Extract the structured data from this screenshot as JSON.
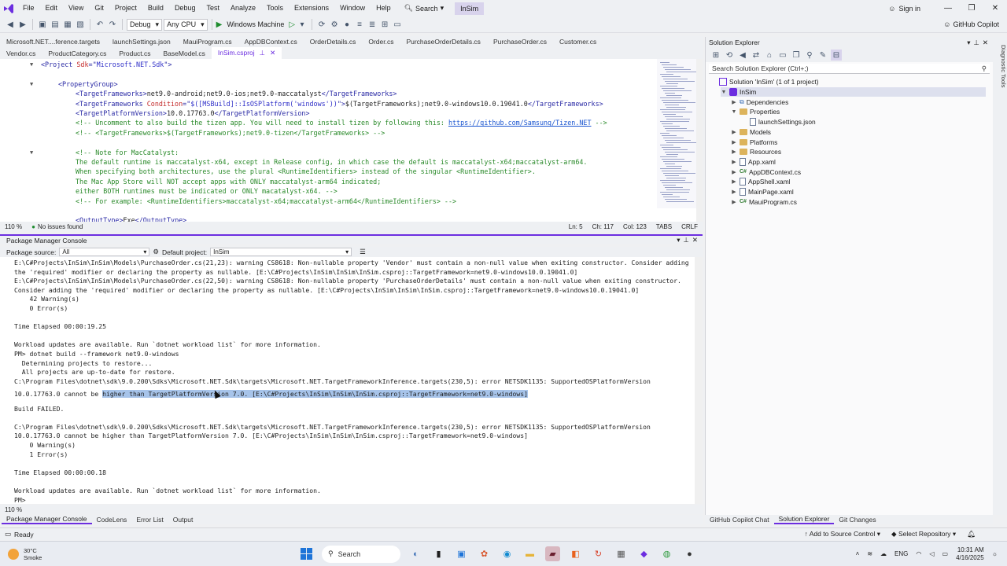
{
  "colors": {
    "accent": "#6c2ee0",
    "selection": "#a7c4ea",
    "xml_tag": "#2a2aa5",
    "xml_attr": "#c42a2a",
    "comment": "#2a8a2a"
  },
  "menubar": {
    "items": [
      "File",
      "Edit",
      "View",
      "Git",
      "Project",
      "Build",
      "Debug",
      "Test",
      "Analyze",
      "Tools",
      "Extensions",
      "Window",
      "Help"
    ],
    "search_label": "Search",
    "solution_name": "InSim",
    "sign_in": "Sign in"
  },
  "toolbar": {
    "config": "Debug",
    "platform": "Any CPU",
    "run_target": "Windows Machine",
    "copilot": "GitHub Copilot"
  },
  "doc_tabs_row1": [
    "Microsoft.NET....ference.targets",
    "launchSettings.json",
    "MauiProgram.cs",
    "AppDBContext.cs",
    "OrderDetails.cs",
    "Order.cs",
    "PurchaseOrderDetails.cs",
    "PurchaseOrder.cs",
    "Customer.cs"
  ],
  "doc_tabs_row2": [
    "Vendor.cs",
    "ProductCategory.cs",
    "Product.cs",
    "BaseModel.cs"
  ],
  "active_tab": "InSim.csproj",
  "editor": {
    "lines": [
      {
        "parts": [
          [
            "tag",
            "<Project "
          ],
          [
            "attr",
            "Sdk"
          ],
          [
            "tag",
            "=\""
          ],
          [
            "val",
            "Microsoft.NET.Sdk"
          ],
          [
            "tag",
            "\">"
          ]
        ]
      },
      {
        "parts": []
      },
      {
        "parts": [
          [
            "tag",
            "<PropertyGroup>"
          ]
        ]
      },
      {
        "parts": [
          [
            "tag",
            "<TargetFrameworks>"
          ],
          [
            "text",
            "net9.0-android;net9.0-ios;net9.0-maccatalyst"
          ],
          [
            "tag",
            "</TargetFrameworks>"
          ]
        ]
      },
      {
        "parts": [
          [
            "tag",
            "<TargetFrameworks "
          ],
          [
            "attr",
            "Condition"
          ],
          [
            "tag",
            "=\""
          ],
          [
            "val",
            "$([MSBuild]::IsOSPlatform('windows'))"
          ],
          [
            "tag",
            "\">"
          ],
          [
            "text",
            "$(TargetFrameworks);net9.0-windows10.0.19041.0"
          ],
          [
            "tag",
            "</TargetFrameworks>"
          ]
        ]
      },
      {
        "parts": [
          [
            "tag",
            "<TargetPlatformVersion>"
          ],
          [
            "text",
            "10.0.17763.0"
          ],
          [
            "tag",
            "</TargetPlatformVersion>"
          ]
        ]
      },
      {
        "parts": [
          [
            "comment",
            "<!-- Uncomment to also build the tizen app. You will need to install tizen by following this: "
          ],
          [
            "link",
            "https://github.com/Samsung/Tizen.NET"
          ],
          [
            "comment",
            " -->"
          ]
        ]
      },
      {
        "parts": [
          [
            "comment",
            "<!-- <TargetFrameworks>$(TargetFrameworks);net9.0-tizen</TargetFrameworks> -->"
          ]
        ]
      },
      {
        "parts": []
      },
      {
        "parts": [
          [
            "comment",
            "<!-- Note for MacCatalyst:"
          ]
        ]
      },
      {
        "parts": [
          [
            "comment",
            "The default runtime is maccatalyst-x64, except in Release config, in which case the default is maccatalyst-x64;maccatalyst-arm64."
          ]
        ]
      },
      {
        "parts": [
          [
            "comment",
            "When specifying both architectures, use the plural <RuntimeIdentifiers> instead of the singular <RuntimeIdentifier>."
          ]
        ]
      },
      {
        "parts": [
          [
            "comment",
            "The Mac App Store will NOT accept apps with ONLY maccatalyst-arm64 indicated;"
          ]
        ]
      },
      {
        "parts": [
          [
            "comment",
            "either BOTH runtimes must be indicated or ONLY macatalyst-x64. -->"
          ]
        ]
      },
      {
        "parts": [
          [
            "comment",
            "<!-- For example: <RuntimeIdentifiers>maccatalyst-x64;maccatalyst-arm64</RuntimeIdentifiers> -->"
          ]
        ]
      },
      {
        "parts": []
      },
      {
        "parts": [
          [
            "tag",
            "<OutputType>"
          ],
          [
            "text",
            "Exe"
          ],
          [
            "tag",
            "</OutputType>"
          ]
        ]
      }
    ]
  },
  "editor_status": {
    "zoom": "110 %",
    "issues": "No issues found",
    "ln": "Ln: 5",
    "ch": "Ch: 117",
    "col": "Col: 123",
    "tabs": "TABS",
    "eol": "CRLF"
  },
  "pmc": {
    "title": "Package Manager Console",
    "source_label": "Package source:",
    "source_value": "All",
    "project_label": "Default project:",
    "project_value": "InSim",
    "lines": [
      "E:\\C#Projects\\InSim\\InSim\\Models\\PurchaseOrder.cs(21,23): warning CS8618: Non-nullable property 'Vendor' must contain a non-null value when exiting constructor. Consider adding",
      "the 'required' modifier or declaring the property as nullable. [E:\\C#Projects\\InSim\\InSim\\InSim.csproj::TargetFramework=net9.0-windows10.0.19041.0]",
      "E:\\C#Projects\\InSim\\InSim\\Models\\PurchaseOrder.cs(22,50): warning CS8618: Non-nullable property 'PurchaseOrderDetails' must contain a non-null value when exiting constructor.",
      "Consider adding the 'required' modifier or declaring the property as nullable. [E:\\C#Projects\\InSim\\InSim\\InSim.csproj::TargetFramework=net9.0-windows10.0.19041.0]",
      "    42 Warning(s)",
      "    0 Error(s)",
      "",
      "Time Elapsed 00:00:19.25",
      "",
      "Workload updates are available. Run `dotnet workload list` for more information.",
      "PM> dotnet build --framework net9.0-windows",
      "  Determining projects to restore...",
      "  All projects are up-to-date for restore.",
      "C:\\Program Files\\dotnet\\sdk\\9.0.200\\Sdks\\Microsoft.NET.Sdk\\targets\\Microsoft.NET.TargetFrameworkInference.targets(230,5): error NETSDK1135: SupportedOSPlatformVersion",
      "",
      "",
      "Build FAILED.",
      "",
      "C:\\Program Files\\dotnet\\sdk\\9.0.200\\Sdks\\Microsoft.NET.Sdk\\targets\\Microsoft.NET.TargetFrameworkInference.targets(230,5): error NETSDK1135: SupportedOSPlatformVersion",
      "10.0.17763.0 cannot be higher than TargetPlatformVersion 7.0. [E:\\C#Projects\\InSim\\InSim\\InSim.csproj::TargetFramework=net9.0-windows]",
      "    0 Warning(s)",
      "    1 Error(s)",
      "",
      "Time Elapsed 00:00:00.18",
      "",
      "Workload updates are available. Run `dotnet workload list` for more information.",
      "PM>"
    ],
    "selected_prefix": "10.0.17763.0 cannot be ",
    "selected_text": "higher than TargetPlatformVersion 7.0. [E:\\C#Projects\\InSim\\InSim\\InSim.csproj::TargetFramework=net9.0-windows]",
    "zoom": "110 %"
  },
  "bottom_tabs_left": [
    "Package Manager Console",
    "CodeLens",
    "Error List",
    "Output"
  ],
  "bottom_tabs_right": [
    "GitHub Copilot Chat",
    "Solution Explorer",
    "Git Changes"
  ],
  "solution_explorer": {
    "title": "Solution Explorer",
    "search_placeholder": "Search Solution Explorer (Ctrl+;)",
    "items": [
      {
        "label": "Solution 'InSim' (1 of 1 project)",
        "icon": "solution-icon",
        "indent": 0,
        "chev": ""
      },
      {
        "label": "InSim",
        "icon": "project-icon",
        "indent": 1,
        "chev": "▼"
      },
      {
        "label": "Dependencies",
        "icon": "dependencies-icon",
        "indent": 2,
        "chev": "▶"
      },
      {
        "label": "Properties",
        "icon": "folder-icon",
        "indent": 2,
        "chev": "▼"
      },
      {
        "label": "launchSettings.json",
        "icon": "file-icon",
        "indent": 3,
        "chev": ""
      },
      {
        "label": "Models",
        "icon": "folder-icon",
        "indent": 2,
        "chev": "▶"
      },
      {
        "label": "Platforms",
        "icon": "folder-icon",
        "indent": 2,
        "chev": "▶"
      },
      {
        "label": "Resources",
        "icon": "folder-icon",
        "indent": 2,
        "chev": "▶"
      },
      {
        "label": "App.xaml",
        "icon": "file-icon",
        "indent": 2,
        "chev": "▶"
      },
      {
        "label": "AppDBContext.cs",
        "icon": "csharp-icon",
        "indent": 2,
        "chev": "▶"
      },
      {
        "label": "AppShell.xaml",
        "icon": "file-icon",
        "indent": 2,
        "chev": "▶"
      },
      {
        "label": "MainPage.xaml",
        "icon": "file-icon",
        "indent": 2,
        "chev": "▶"
      },
      {
        "label": "MauiProgram.cs",
        "icon": "csharp-icon",
        "indent": 2,
        "chev": "▶"
      }
    ]
  },
  "diagnostic_tools": "Diagnostic Tools",
  "statusbar": {
    "ready": "Ready",
    "add_source_control": "Add to Source Control",
    "select_repository": "Select Repository"
  },
  "taskbar": {
    "weather_temp": "30°C",
    "weather_desc": "Smoke",
    "search": "Search",
    "lang": "ENG",
    "time": "10:31 AM",
    "date": "4/16/2025"
  }
}
